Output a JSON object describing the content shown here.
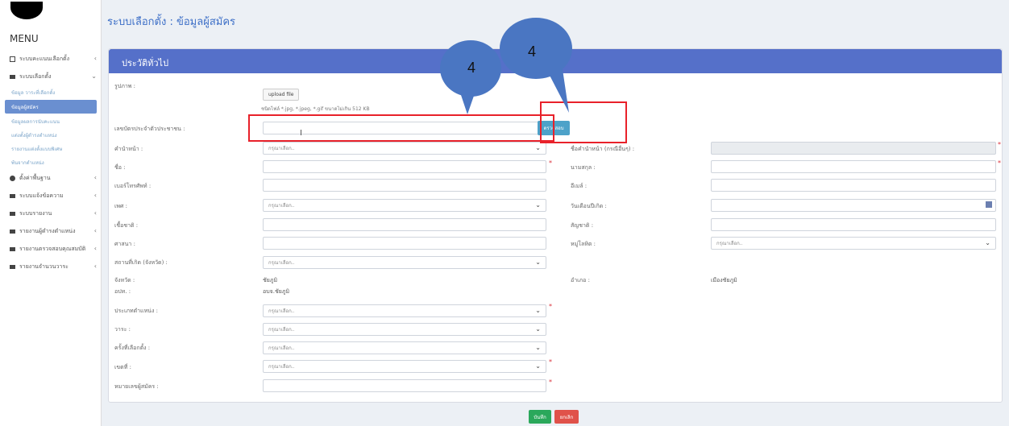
{
  "sidebar": {
    "menu_title": "MENU",
    "items": [
      {
        "label": "ระบบคะแนนเลือกตั้ง",
        "icon": "grid-icon"
      },
      {
        "label": "ระบบเลือกตั้ง",
        "icon": "folder-icon"
      },
      {
        "label": "ข้อมูล วาระที่เลือกตั้ง",
        "sub": true
      },
      {
        "label": "ข้อมูลผู้สมัคร",
        "sub": true,
        "active": true
      },
      {
        "label": "ข้อมูลผลการนับคะแนน",
        "sub": true
      },
      {
        "label": "แต่งตั้งผู้ดำรงตำแหน่ง",
        "sub": true
      },
      {
        "label": "รายงานแต่งตั้งแบบพิเศษ",
        "sub": true
      },
      {
        "label": "พ้นจากตำแหน่ง",
        "sub": true
      },
      {
        "label": "ตั้งค่าพื้นฐาน",
        "icon": "gear-icon"
      },
      {
        "label": "ระบบแจ้งข้อความ",
        "icon": "message-icon"
      },
      {
        "label": "ระบบรายงาน",
        "icon": "report-icon"
      },
      {
        "label": "รายงานผู้ดำรงตำแหน่ง",
        "icon": "report-icon"
      },
      {
        "label": "รายงานตรวจสอบคุณสมบัติ",
        "icon": "report-icon"
      },
      {
        "label": "รายงานจำนวนวาระ",
        "icon": "report-icon"
      }
    ]
  },
  "header": {
    "title": "ระบบเลือกตั้ง : ข้อมูลผู้สมัคร"
  },
  "panel": {
    "title": "ประวัติทั่วไป",
    "photo_label": "รูปภาพ :",
    "upload_label": "upload file",
    "upload_hint": "ชนิดไฟล์ *.jpg, *.jpeg, *.gif ขนาดไม่เกิน 512 KB",
    "check_label": "ตรวจสอบ",
    "placeholder_select": "กรุณาเลือก..",
    "fields_left": [
      {
        "label": "เลขบัตรประจำตัวประชาชน :"
      },
      {
        "label": "คำนำหน้า :"
      },
      {
        "label": "ชื่อ :"
      },
      {
        "label": "เบอร์โทรศัพท์ :"
      },
      {
        "label": "เพศ :"
      },
      {
        "label": "เชื้อชาติ :"
      },
      {
        "label": "ศาสนา :"
      },
      {
        "label": "สถานที่เกิด (จังหวัด) :"
      },
      {
        "label": "จังหวัด :"
      },
      {
        "label": "อปท. :"
      },
      {
        "label": "ประเภทตำแหน่ง :"
      },
      {
        "label": "วาระ :"
      },
      {
        "label": "ครั้งที่เลือกตั้ง :"
      },
      {
        "label": "เขตที่ :"
      },
      {
        "label": "หมายเลขผู้สมัคร :"
      }
    ],
    "fields_right": [
      {
        "label": "ชื่อคำนำหน้า (กรณีอื่นๆ) :"
      },
      {
        "label": "นามสกุล :"
      },
      {
        "label": "อีเมล์ :"
      },
      {
        "label": "วันเดือนปีเกิด :"
      },
      {
        "label": "สัญชาติ :"
      },
      {
        "label": "หมู่โลหิต :"
      },
      {
        "label": "อำเภอ :"
      }
    ],
    "province_value": "ชัยภูมิ",
    "org_value": "อบจ.ชัยภูมิ",
    "district_value": "เมืองชัยภูมิ"
  },
  "buttons": {
    "save": "บันทึก",
    "cancel": "ยกเลิก"
  },
  "annotations": {
    "bubble_1": "4",
    "bubble_2": "4"
  },
  "colors": {
    "accent": "#5570c9",
    "annotation": "#e8212a",
    "bubble": "#4a76c2"
  }
}
